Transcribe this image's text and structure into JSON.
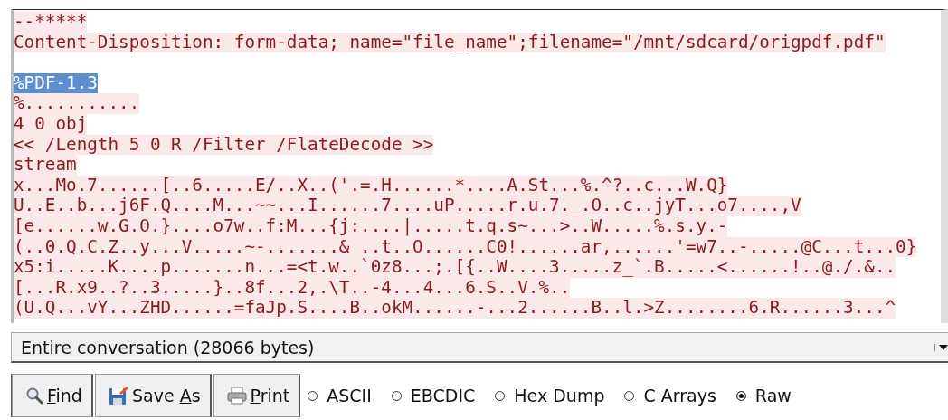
{
  "stream": {
    "lines": [
      {
        "kind": "data",
        "text": "--*****",
        "selected": false
      },
      {
        "kind": "data",
        "text": "Content-Disposition: form-data; name=\"file_name\";filename=\"/mnt/sdcard/origpdf.pdf\"",
        "selected": false
      },
      {
        "kind": "blank"
      },
      {
        "kind": "data",
        "text": "%PDF-1.3",
        "selected": true
      },
      {
        "kind": "data",
        "text": "%...........",
        "selected": false
      },
      {
        "kind": "data",
        "text": "4 0 obj",
        "selected": false
      },
      {
        "kind": "data",
        "text": "<< /Length 5 0 R /Filter /FlateDecode >>",
        "selected": false
      },
      {
        "kind": "data",
        "text": "stream",
        "selected": false
      },
      {
        "kind": "data",
        "text": "x...Mo.7......[..6.....E/..X..('.=.H......*....A.St...%.^?..c...W.Q}",
        "selected": false
      },
      {
        "kind": "data",
        "text": "U..E..b...j6F.Q....M...~~...I......7....uP.....r.u.7._.O..c..jyT...o7....,V",
        "selected": false
      },
      {
        "kind": "data",
        "text": "[e......w.G.O.}....o7w..f:M...{j:....|.....t.q.s~...>..W.....%.s.y.-",
        "selected": false
      },
      {
        "kind": "data",
        "text": "(..0.Q.C.Z..y...V.....~-.......& ..t..O......C0!......ar,......'=w7..-.....@C...t...0}",
        "selected": false
      },
      {
        "kind": "data",
        "text": "x5:i.....K....p.......n...=<t.w..`0z8...;.[{..W....3.....z_`.B.....<......!..@./.&..",
        "selected": false
      },
      {
        "kind": "data",
        "text": "[...R.x9..?..3.....}..8f...2,.\\T..-4...4...6.S..V.%..",
        "selected": false
      },
      {
        "kind": "data",
        "text": "(U.Q...vY...ZHD......=faJp.S....B..okM......-...2......B..l.>Z........6.R......3...^",
        "selected": false
      }
    ]
  },
  "conversation_select": {
    "value": "Entire conversation (28066 bytes)"
  },
  "buttons": [
    {
      "kind": "find",
      "key": "F",
      "after": "ind"
    },
    {
      "kind": "save",
      "before": "Save ",
      "key": "A",
      "after": "s"
    },
    {
      "kind": "print",
      "key": "P",
      "after": "rint"
    }
  ],
  "formats": [
    {
      "label": "ASCII",
      "selected": false
    },
    {
      "label": "EBCDIC",
      "selected": false
    },
    {
      "label": "Hex Dump",
      "selected": false
    },
    {
      "label": "C Arrays",
      "selected": false
    },
    {
      "label": "Raw",
      "selected": true
    }
  ]
}
